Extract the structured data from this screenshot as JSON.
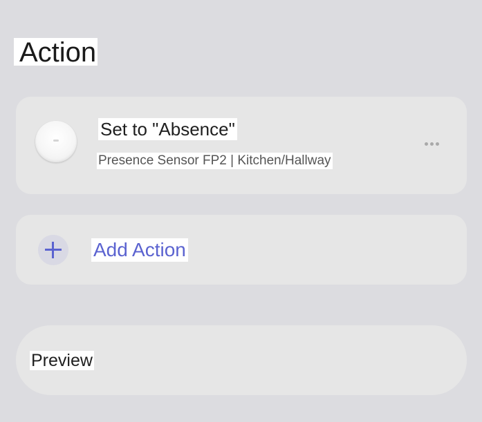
{
  "section": {
    "title": "Action"
  },
  "action_item": {
    "title": "Set to \"Absence\"",
    "subtitle": "Presence Sensor FP2 | Kitchen/Hallway",
    "device_icon": "presence-sensor-fp2-icon",
    "more_icon": "more-options-icon"
  },
  "add_action": {
    "label": "Add Action",
    "icon": "plus-icon",
    "accent_color": "#5b63d0"
  },
  "preview": {
    "label": "Preview"
  },
  "colors": {
    "background": "#dcdce0",
    "card": "#e6e6e6",
    "accent": "#5b63d0"
  }
}
